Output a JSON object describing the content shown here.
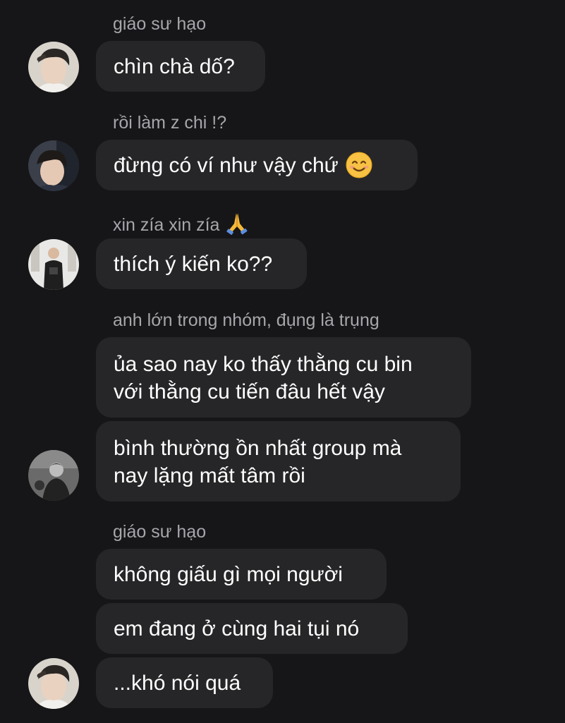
{
  "messages": [
    {
      "sender": "giáo sư hạo",
      "text": "chìn chà dố?"
    },
    {
      "sender": "rồi làm z chi !?",
      "text": "đừng có ví như vậy chứ",
      "emoji": "smiling-face-icon"
    },
    {
      "sender": "xin zía xin zía",
      "sender_emoji": "folded-hands-icon",
      "text": "thích ý kiến ko??"
    },
    {
      "sender": "anh lớn trong nhóm, đụng là trụng",
      "text1_line1": "ủa sao nay ko thấy thằng cu bin",
      "text1_line2": "với thằng cu tiến đâu hết vậy",
      "text2_line1": "bình thường ồn nhất group mà",
      "text2_line2": "nay lặng mất tâm rồi"
    },
    {
      "sender": "giáo sư hạo",
      "text1": "không giấu gì mọi người",
      "text2": "em đang ở cùng hai tụi nó",
      "text3": "...khó nói quá"
    }
  ],
  "colors": {
    "background": "#161618",
    "bubble": "#262628",
    "sender_text": "#a6a6ab",
    "message_text": "#ffffff"
  }
}
